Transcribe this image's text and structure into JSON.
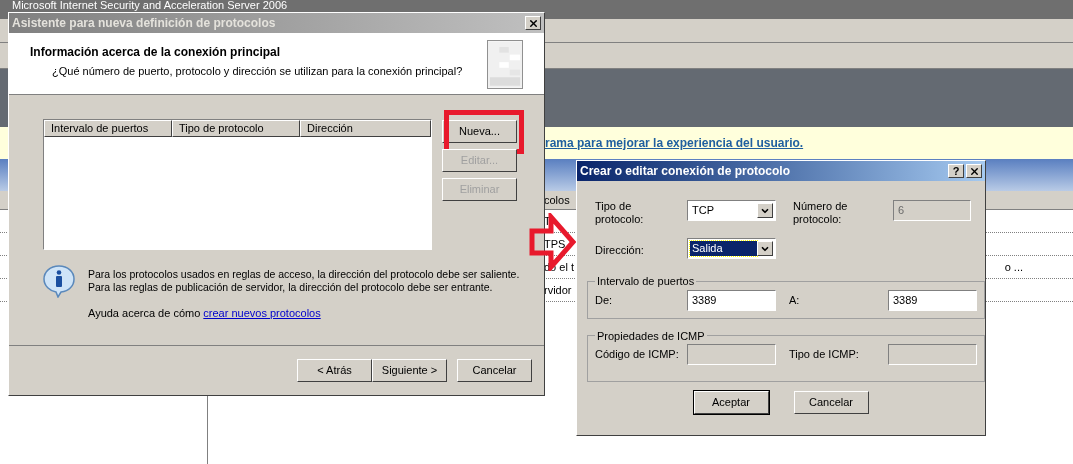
{
  "background_window": {
    "title": "Microsoft Internet Security and Acceleration Server 2006",
    "banner_link": "rama para mejorar la experiencia del usuario.",
    "list_header": "colos",
    "rows": [
      {
        "cells": [
          "T"
        ]
      },
      {
        "cells": [
          "TPS"
        ]
      },
      {
        "cells": [
          "do el t",
          "o ..."
        ]
      },
      {
        "cells": [
          "rvidor"
        ]
      }
    ]
  },
  "wizard": {
    "title": "Asistente para nueva definición de protocolos",
    "header_title": "Información acerca de la conexión principal",
    "header_subtitle": "¿Qué número de puerto, protocolo y dirección se utilizan para la conexión principal?",
    "columns": [
      "Intervalo de puertos",
      "Tipo de protocolo",
      "Dirección"
    ],
    "side_buttons": [
      {
        "label": "Nueva...",
        "disabled": false,
        "highlighted": true
      },
      {
        "label": "Editar...",
        "disabled": true,
        "highlighted": false
      },
      {
        "label": "Eliminar",
        "disabled": true,
        "highlighted": false
      }
    ],
    "info_lines": [
      "Para los protocolos usados en reglas de acceso, la dirección del protocolo debe ser saliente.",
      "Para las reglas de publicación de servidor, la dirección del protocolo debe ser entrante."
    ],
    "help_text": "Ayuda acerca de cómo",
    "help_link": "crear nuevos protocolos",
    "nav_buttons": [
      {
        "label": "< Atrás",
        "disabled": false
      },
      {
        "label": "Siguiente >",
        "disabled": false
      },
      {
        "label": "Cancelar",
        "disabled": false
      }
    ]
  },
  "protocol_dialog": {
    "title": "Crear o editar conexión de protocolo",
    "help_button": "?",
    "protocol_type": {
      "label": "Tipo de protocolo:",
      "value": "TCP",
      "selected": false
    },
    "protocol_number": {
      "label": "Número de protocolo:",
      "value": "6",
      "disabled": true
    },
    "direction": {
      "label": "Dirección:",
      "value": "Salida",
      "selected": true
    },
    "port_range": {
      "title": "Intervalo de puertos",
      "from": {
        "label": "De:",
        "value": "3389"
      },
      "to": {
        "label": "A:",
        "value": "3389"
      }
    },
    "icmp": {
      "title": "Propiedades de ICMP",
      "code": {
        "label": "Código de ICMP:",
        "disabled": true
      },
      "type": {
        "label": "Tipo de ICMP:",
        "disabled": true
      }
    },
    "buttons": [
      {
        "label": "Aceptar",
        "default": true
      },
      {
        "label": "Cancelar",
        "default": false
      }
    ]
  }
}
